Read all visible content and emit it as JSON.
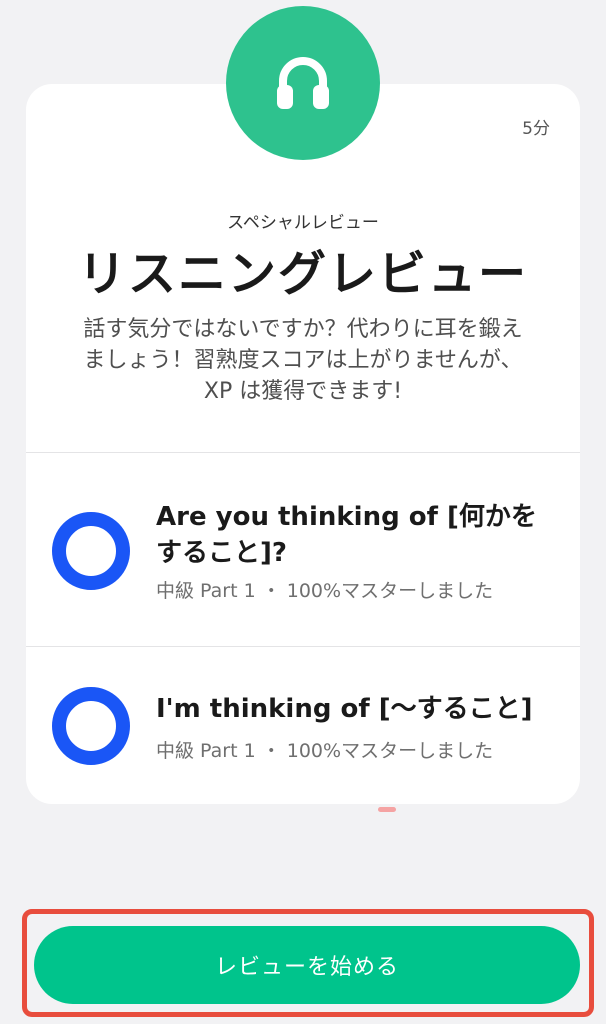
{
  "card": {
    "icon": "headphones-icon",
    "duration": "5分",
    "kicker": "スペシャルレビュー",
    "title": "リスニングレビュー",
    "description": "話す気分ではないですか？代わりに耳を鍛え\nましょう！習熟度スコアは上がりませんが、\nXP は獲得できます!"
  },
  "lessons": [
    {
      "title": "Are you thinking of [何かをすること]?",
      "meta": "中級 Part 1 ・ 100%マスターしました",
      "icon": "circle-ring-icon"
    },
    {
      "title": "I'm thinking of [〜すること]",
      "meta": "中級 Part 1 ・ 100%マスターしました",
      "icon": "circle-ring-icon"
    }
  ],
  "start_button": {
    "label": "レビューを始める"
  },
  "colors": {
    "accent_green": "#00c48c",
    "icon_green": "#2ec28e",
    "ring_blue": "#1a56f6",
    "highlight_red": "#e84d3d"
  }
}
